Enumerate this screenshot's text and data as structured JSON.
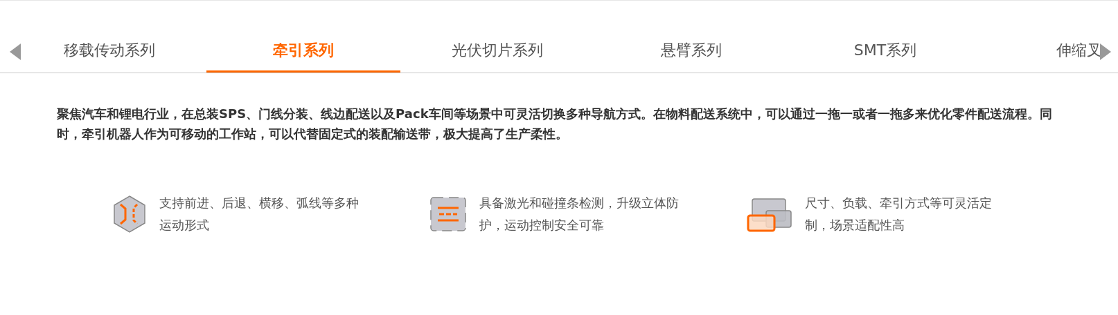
{
  "tabs": [
    {
      "label": "移载传动系列",
      "selected": false
    },
    {
      "label": "牵引系列",
      "selected": true
    },
    {
      "label": "光伏切片系列",
      "selected": false
    },
    {
      "label": "悬臂系列",
      "selected": false
    },
    {
      "label": "SMT系列",
      "selected": false
    },
    {
      "label": "伸缩叉",
      "selected": false
    }
  ],
  "description": "聚焦汽车和锂电行业，在总装SPS、门线分装、线边配送以及Pack车间等场景中可灵活切换多种导航方式。在物料配送系统中，可以通过一拖一或者一拖多来优化零件配送流程。同时，牵引机器人作为可移动的工作站，可以代替固定式的装配输送带，极大提高了生产柔性。",
  "features": [
    {
      "kind": "motion",
      "text": "支持前进、后退、横移、弧线等多种运动形式"
    },
    {
      "kind": "safety",
      "text": "具备激光和碰撞条检测，升级立体防护，运动控制安全可靠"
    },
    {
      "kind": "custom",
      "text": "尺寸、负载、牵引方式等可灵活定制，场景适配性高"
    }
  ]
}
